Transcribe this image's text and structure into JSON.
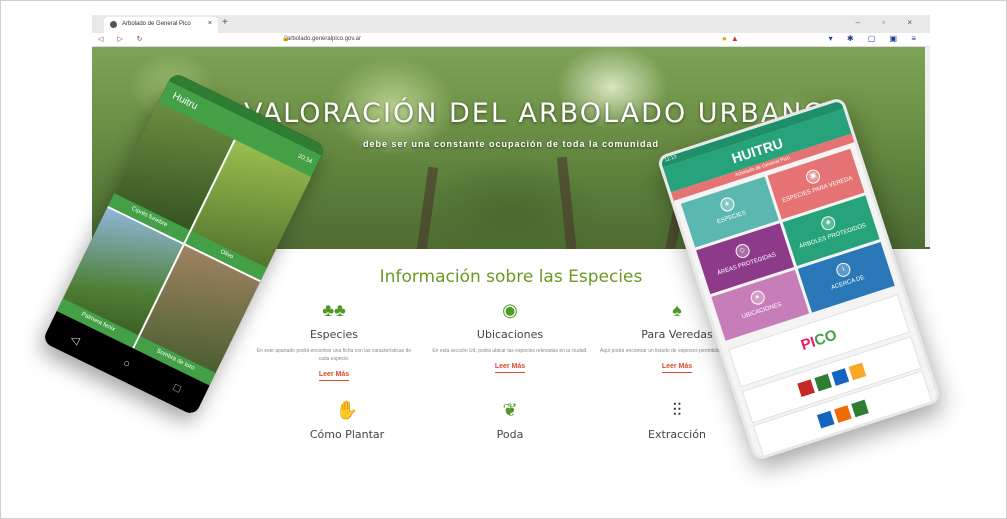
{
  "browser": {
    "tab_title": "Arbolado de General Pico",
    "url": "arbolado.generalpico.gov.ar",
    "tab_close": "×",
    "new_tab": "+",
    "window_controls": "–  ▫  ×"
  },
  "hero": {
    "title": "LA VALORACIÓN DEL ARBOLADO URBANO",
    "subtitle": "debe ser una constante ocupación de toda la comunidad"
  },
  "section": {
    "title": "Información sobre las Especies"
  },
  "cards": [
    {
      "title": "Especies",
      "desc": "En este apartado podrá encontrar una ficha con las características de cada especie.",
      "more": "Leer Más"
    },
    {
      "title": "Ubicaciones",
      "desc": "En esta sección Ud. podrá ubicar las especies relevadas en la ciudad.",
      "more": "Leer Más"
    },
    {
      "title": "Para Veredas",
      "desc": "Aquí podrá encontrar un listado de especies permitidos para veredas.",
      "more": "Leer Más"
    }
  ],
  "bottom_cards": [
    {
      "title": "Cómo Plantar"
    },
    {
      "title": "Poda"
    },
    {
      "title": "Extracción"
    }
  ],
  "phone_left": {
    "app_title": "Huitru",
    "clock": "20:34",
    "tiles": [
      "Ciprés funebre",
      "Olivo",
      "Palmera fenix",
      "Sombra de toro"
    ]
  },
  "phone_right": {
    "status": "11:13",
    "app_title": "HUITRU",
    "subtitle": "Arbolado de General Pico",
    "tiles": [
      {
        "label": "ESPECIES",
        "color": "#5ab8b0"
      },
      {
        "label": "ESPECIES PARA VEREDA",
        "color": "#e57373"
      },
      {
        "label": "ÁREAS PROTEGIDAS",
        "color": "#8e3a8a"
      },
      {
        "label": "ÁRBOLES PROTEGIDOS",
        "color": "#26a37a"
      },
      {
        "label": "UBICACIONES",
        "color": "#c77db7"
      },
      {
        "label": "ACERCA DE",
        "color": "#2a78b8"
      }
    ],
    "logo_a": "PI",
    "logo_b": "CO"
  }
}
